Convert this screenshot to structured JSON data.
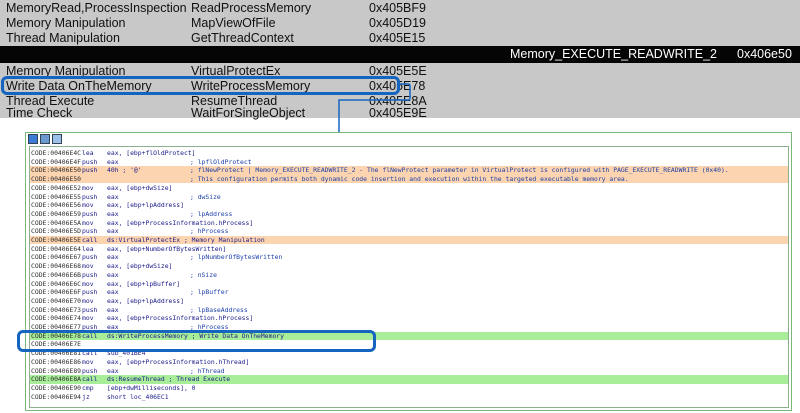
{
  "api_table": {
    "rows_group1": [
      {
        "category": "MemoryRead,ProcessInspection",
        "api": "ReadProcessMemory",
        "address": "0x405BF9"
      },
      {
        "category": "Memory Manipulation",
        "api": "MapViewOfFile",
        "address": "0x405D19"
      },
      {
        "category": "Thread Manipulation",
        "api": "GetThreadContext",
        "address": "0x405E15"
      }
    ],
    "black_row": {
      "label": "Memory_EXECUTE_READWRITE_2",
      "address": "0x406e50"
    },
    "rows_group2": [
      {
        "category": "Memory Manipulation",
        "api": "VirtualProtectEx",
        "address": "0x405E5E"
      },
      {
        "category": "Write Data OnTheMemory",
        "api": "WriteProcessMemory",
        "address": "0x405E78"
      },
      {
        "category": "Thread Execute",
        "api": "ResumeThread",
        "address": "0x405E8A"
      },
      {
        "category": "Time Check",
        "api": "WaitForSingleObject",
        "address": "0x405E9E"
      }
    ]
  },
  "colors": {
    "highlight_orange": "#fcd4b0",
    "highlight_green": "#a8ee98",
    "callout_blue": "#1565c0",
    "table_gray": "#c8c8c8"
  },
  "toolbar_icons": [
    "graph-view-icon",
    "text-view-icon",
    "list-view-icon"
  ],
  "disasm": [
    {
      "addr": "CODE:00406E4C",
      "mn": "lea",
      "op": "eax, [ebp+flOldProtect]",
      "cm": "",
      "hl": ""
    },
    {
      "addr": "CODE:00406E4F",
      "mn": "push",
      "op": "eax",
      "cm": "; lpflOldProtect",
      "hl": ""
    },
    {
      "addr": "CODE:00406E50",
      "mn": "push",
      "op": "40h ; '@'",
      "cm": "; flNewProtect | Memory_EXECUTE_READWRITE_2 - The flNewProtect parameter in VirtualProtect is configured with PAGE_EXECUTE_READWRITE (0x40).",
      "hl": "orange"
    },
    {
      "addr": "CODE:00406E50",
      "mn": "",
      "op": "",
      "cm": "; This configuration permits both dynamic code insertion and execution within the targeted executable memory area.",
      "hl": "orange"
    },
    {
      "addr": "CODE:00406E52",
      "mn": "mov",
      "op": "eax, [ebp+dwSize]",
      "cm": "",
      "hl": ""
    },
    {
      "addr": "CODE:00406E55",
      "mn": "push",
      "op": "eax",
      "cm": "; dwSize",
      "hl": ""
    },
    {
      "addr": "CODE:00406E56",
      "mn": "mov",
      "op": "eax, [ebp+lpAddress]",
      "cm": "",
      "hl": ""
    },
    {
      "addr": "CODE:00406E59",
      "mn": "push",
      "op": "eax",
      "cm": "; lpAddress",
      "hl": ""
    },
    {
      "addr": "CODE:00406E5A",
      "mn": "mov",
      "op": "eax, [ebp+ProcessInformation.hProcess]",
      "cm": "",
      "hl": ""
    },
    {
      "addr": "CODE:00406E5D",
      "mn": "push",
      "op": "eax",
      "cm": "; hProcess",
      "hl": ""
    },
    {
      "addr": "CODE:00406E5E",
      "mn": "call",
      "op": "ds:VirtualProtectEx ; Memory Manipulation",
      "cm": "",
      "hl": "orange"
    },
    {
      "addr": "CODE:00406E64",
      "mn": "lea",
      "op": "eax, [ebp+NumberOfBytesWritten]",
      "cm": "",
      "hl": ""
    },
    {
      "addr": "CODE:00406E67",
      "mn": "push",
      "op": "eax",
      "cm": "; lpNumberOfBytesWritten",
      "hl": ""
    },
    {
      "addr": "CODE:00406E68",
      "mn": "mov",
      "op": "eax, [ebp+dwSize]",
      "cm": "",
      "hl": ""
    },
    {
      "addr": "CODE:00406E6B",
      "mn": "push",
      "op": "eax",
      "cm": "; nSize",
      "hl": ""
    },
    {
      "addr": "CODE:00406E6C",
      "mn": "mov",
      "op": "eax, [ebp+lpBuffer]",
      "cm": "",
      "hl": ""
    },
    {
      "addr": "CODE:00406E6F",
      "mn": "push",
      "op": "eax",
      "cm": "; lpBuffer",
      "hl": ""
    },
    {
      "addr": "CODE:00406E70",
      "mn": "mov",
      "op": "eax, [ebp+lpAddress]",
      "cm": "",
      "hl": ""
    },
    {
      "addr": "CODE:00406E73",
      "mn": "push",
      "op": "eax",
      "cm": "; lpBaseAddress",
      "hl": ""
    },
    {
      "addr": "CODE:00406E74",
      "mn": "mov",
      "op": "eax, [ebp+ProcessInformation.hProcess]",
      "cm": "",
      "hl": ""
    },
    {
      "addr": "CODE:00406E77",
      "mn": "push",
      "op": "eax",
      "cm": "; hProcess",
      "hl": ""
    },
    {
      "addr": "CODE:00406E78",
      "mn": "call",
      "op": "ds:WriteProcessMemory ; Write Data OnTheMemory",
      "cm": "",
      "hl": "green"
    },
    {
      "addr": "CODE:00406E7E",
      "mn": "",
      "op": "",
      "cm": "",
      "hl": ""
    },
    {
      "addr": "CODE:00406E81",
      "mn": "call",
      "op": "sub_401BE4",
      "cm": "",
      "hl": ""
    },
    {
      "addr": "CODE:00406E86",
      "mn": "mov",
      "op": "eax, [ebp+ProcessInformation.hThread]",
      "cm": "",
      "hl": ""
    },
    {
      "addr": "CODE:00406E89",
      "mn": "push",
      "op": "eax",
      "cm": "; hThread",
      "hl": ""
    },
    {
      "addr": "CODE:00406E8A",
      "mn": "call",
      "op": "ds:ResumeThread ; Thread Execute",
      "cm": "",
      "hl": "green"
    },
    {
      "addr": "CODE:00406E90",
      "mn": "cmp",
      "op": "[ebp+dwMilliseconds], 0",
      "cm": "",
      "hl": ""
    },
    {
      "addr": "CODE:00406E94",
      "mn": "jz",
      "op": "short loc_406EC1",
      "cm": "",
      "hl": ""
    }
  ]
}
